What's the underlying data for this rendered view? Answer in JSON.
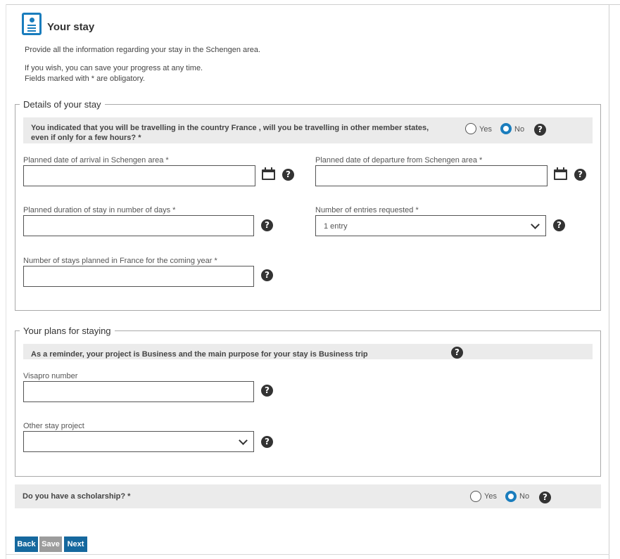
{
  "header": {
    "title": "Your stay",
    "intro_line1": "Provide all the information regarding your stay in the Schengen area.",
    "intro_line2": "If you wish, you can save your progress at any time.",
    "intro_line3": "Fields marked with * are obligatory."
  },
  "details": {
    "legend": "Details of your stay",
    "question_line1": "You indicated that you will be travelling in the country France , will you be travelling in other member states,",
    "question_line2": "even if only for a few hours? *",
    "yes_label": "Yes",
    "no_label": "No",
    "selected": "No",
    "arrival_label": "Planned date of arrival in Schengen area *",
    "arrival_value": "",
    "departure_label": "Planned date of departure from Schengen area *",
    "departure_value": "",
    "duration_label": "Planned duration of stay in number of days *",
    "duration_value": "",
    "entries_label": "Number of entries requested *",
    "entries_value": "1 entry",
    "stays_label": "Number of stays planned in France for the coming year *",
    "stays_value": ""
  },
  "plans": {
    "legend": "Your plans for staying",
    "reminder": "As a reminder, your project is Business and the main purpose for your stay is Business trip",
    "visapro_label": "Visapro number",
    "visapro_value": "",
    "other_label": "Other stay project",
    "other_value": ""
  },
  "scholarship": {
    "question": "Do you have a scholarship? *",
    "yes_label": "Yes",
    "no_label": "No",
    "selected": "No"
  },
  "buttons": {
    "back": "Back",
    "save": "Save",
    "next": "Next"
  },
  "help_glyph": "?",
  "colors": {
    "accent": "#1a7dbd",
    "primary_button": "#15689e",
    "disabled_button": "#9c9c9c",
    "band": "#ebebeb"
  }
}
